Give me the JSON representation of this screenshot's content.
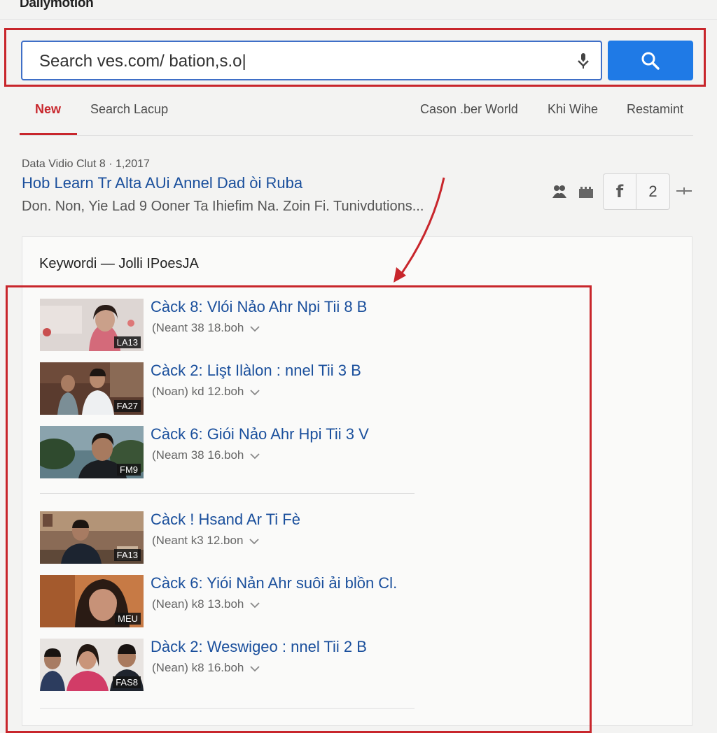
{
  "app": {
    "logo": "Dailymotion"
  },
  "search": {
    "value": "Search ves.com/ bation,s.o|"
  },
  "tabs": [
    {
      "label": "New",
      "active": true
    },
    {
      "label": "Search Lacup"
    },
    {
      "label": "Cason .ber World"
    },
    {
      "label": "Khi Wihe"
    },
    {
      "label": "Restamint"
    }
  ],
  "result": {
    "meta": "Data Vidio Clut 8 · 1,2017",
    "title": "Hob Learn Tr Alta AUi Annel Dad òi Ruba",
    "description": "Don. Non, Yie Lad 9 Ooner Ta Ihiefim Na. Zoin Fi. Tunivdutions...",
    "share_icon": "f",
    "share_count": "2"
  },
  "panel": {
    "heading": "Keywordi — Jolli IPoesJA",
    "items": [
      {
        "title": "Càck 8: Vlói Nảo Ahr Npi Tii 8 B",
        "sub": "(Neant 38 18.boh",
        "badge": "LA13",
        "scene": "woman-smiling"
      },
      {
        "title": "Càck 2: Lişt Ilàlon : nnel Tii 3 B",
        "sub": "(Noan) kd 12.boh",
        "badge": "FA27",
        "scene": "two-men-talking"
      },
      {
        "title": "Càck 6: Giói Nảo Ahr Hpi Tii 3 V",
        "sub": "(Neam 38 16.boh",
        "badge": "FM9",
        "scene": "man-outdoors"
      },
      {
        "title": "Càck ! Hsand Ar Ti Fè",
        "sub": "(Neant k3 12.bon",
        "badge": "FA13",
        "scene": "man-room"
      },
      {
        "title": "Càck 6: Yiói Nản Ahr suôi ải blồn Cl.",
        "sub": "(Nean) k8 13.boh",
        "badge": "MEU",
        "scene": "woman-closeup"
      },
      {
        "title": "Dàck 2: Weswigeo : nnel Tii 2 B",
        "sub": "(Nean) k8 16.boh",
        "badge": "FAS8",
        "scene": "group-three"
      }
    ]
  },
  "colors": {
    "accent_red": "#c8262c",
    "link_blue": "#1a4f9c",
    "button_blue": "#1f7ae6"
  }
}
